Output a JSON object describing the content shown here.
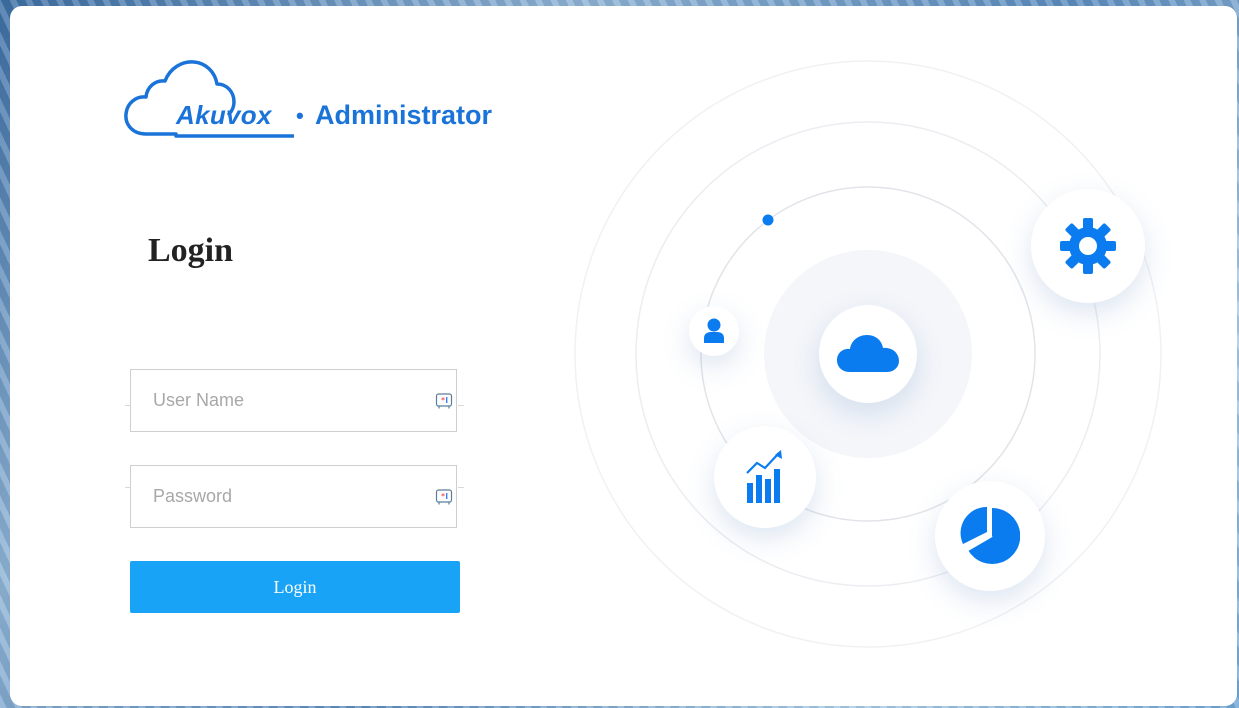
{
  "app": {
    "brand": "Akuvox",
    "separator": "•",
    "product": "Administrator"
  },
  "login": {
    "title": "Login",
    "username_placeholder": "User Name",
    "username_value": "",
    "password_placeholder": "Password",
    "password_value": "",
    "submit_label": "Login"
  },
  "icons": {
    "username_field": "keyboard-badge-icon",
    "password_field": "keyboard-badge-icon",
    "illustration": [
      "gear-icon",
      "user-icon",
      "cloud-icon",
      "bar-chart-icon",
      "pie-chart-icon"
    ]
  },
  "colors": {
    "brand": "#1a73d9",
    "primary_button": "#19a3f7",
    "icon_accent": "#0a7cf0"
  }
}
